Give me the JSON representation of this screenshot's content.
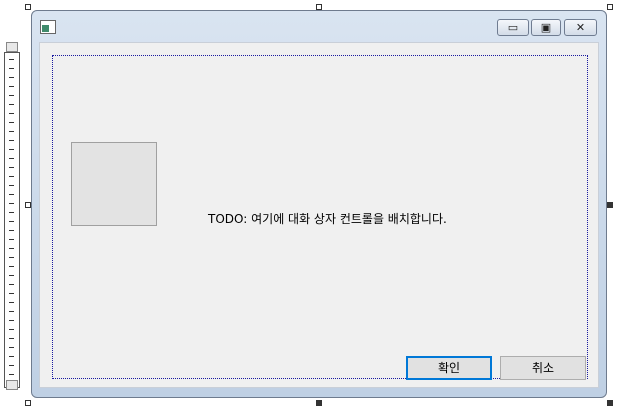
{
  "window": {
    "caption_buttons": {
      "minimize": "▭",
      "maximize": "▣",
      "close": "✕"
    }
  },
  "dialog": {
    "todo_text": "TODO: 여기에 대화 상자 컨트롤을 배치합니다.",
    "ok_label": "확인",
    "cancel_label": "취소"
  },
  "colors": {
    "title_gradient_top": "#d9e4f1",
    "title_gradient_bottom": "#bfd0e4",
    "client_background": "#f0f0f0",
    "default_button_border": "#0078d7",
    "guide_frame": "#1a1aa0"
  }
}
